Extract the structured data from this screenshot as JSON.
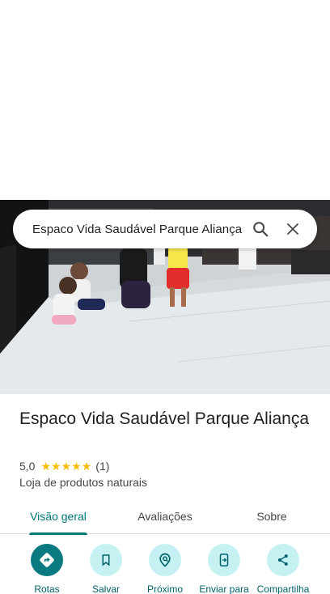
{
  "search": {
    "query": "Espaco Vida Saudável Parque Aliança"
  },
  "place": {
    "title": "Espaco Vida Saudável Parque Aliança",
    "rating": "5,0",
    "stars": 5,
    "review_count": "(1)",
    "category": "Loja de produtos naturais"
  },
  "tabs": [
    {
      "label": "Visão geral",
      "active": true
    },
    {
      "label": "Avaliações",
      "active": false
    },
    {
      "label": "Sobre",
      "active": false
    }
  ],
  "actions": [
    {
      "label": "Rotas",
      "icon": "directions-icon"
    },
    {
      "label": "Salvar",
      "icon": "bookmark-icon"
    },
    {
      "label": "Próximo",
      "icon": "nearby-icon"
    },
    {
      "label": "Enviar para",
      "icon": "send-to-device-icon"
    },
    {
      "label": "Compartilha",
      "icon": "share-icon"
    }
  ],
  "colors": {
    "accent": "#00787a",
    "star": "#fbbc04",
    "action_bg": "#c6f1f2",
    "primary_action": "#0b7a80"
  }
}
